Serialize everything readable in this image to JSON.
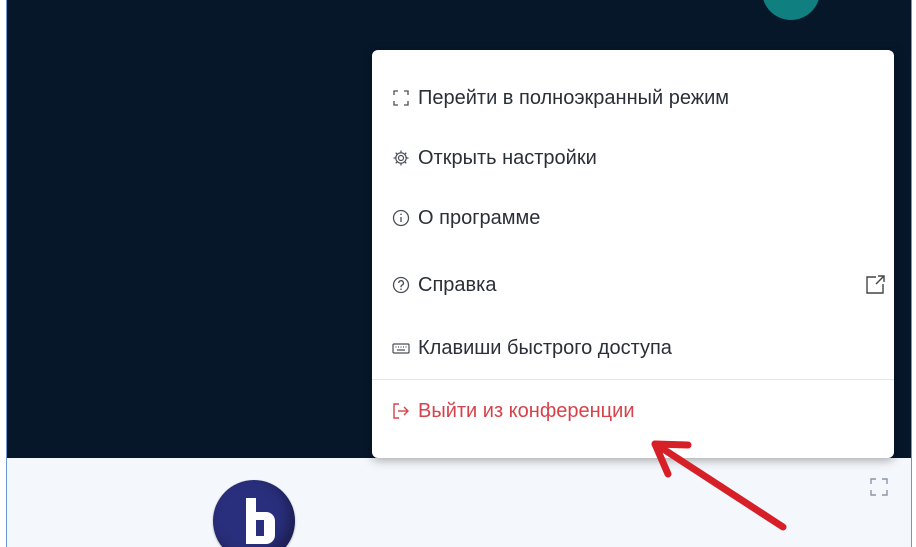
{
  "menu": {
    "items": [
      {
        "label": "Перейти в полноэкранный режим",
        "icon": "fullscreen-icon"
      },
      {
        "label": "Открыть настройки",
        "icon": "settings-icon"
      },
      {
        "label": "О программе",
        "icon": "info-icon"
      },
      {
        "label": "Справка",
        "icon": "help-icon",
        "external_icon": "external-link-icon"
      },
      {
        "label": "Клавиши быстрого доступа",
        "icon": "keyboard-icon"
      }
    ],
    "leave": {
      "label": "Выйти из конференции",
      "icon": "logout-icon"
    }
  },
  "colors": {
    "background_dark": "#06172a",
    "danger": "#d6424a",
    "annotation_arrow": "#d61f26"
  }
}
